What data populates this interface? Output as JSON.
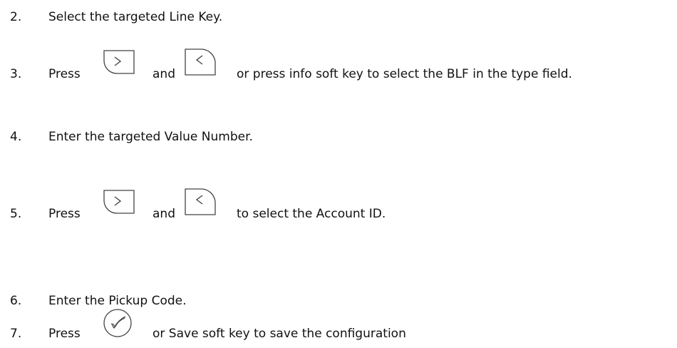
{
  "steps": [
    {
      "num": "2.",
      "text": "Select the targeted Line Key."
    },
    {
      "num": "3.",
      "press": "Press",
      "and": "and",
      "rest": "or press info soft key to select the BLF in the type field."
    },
    {
      "num": "4.",
      "text": "Enter the targeted Value Number."
    },
    {
      "num": "5.",
      "press": "Press",
      "and": "and",
      "rest": "to select the Account ID."
    },
    {
      "num": "6.",
      "text": "Enter the Pickup Code."
    },
    {
      "num": "7.",
      "press": "Press",
      "rest": "or Save soft key to save the configuration"
    }
  ],
  "icons": {
    "right_key": "right-arrow-key-icon",
    "left_key": "left-arrow-key-icon",
    "ok_key": "ok-check-key-icon"
  }
}
